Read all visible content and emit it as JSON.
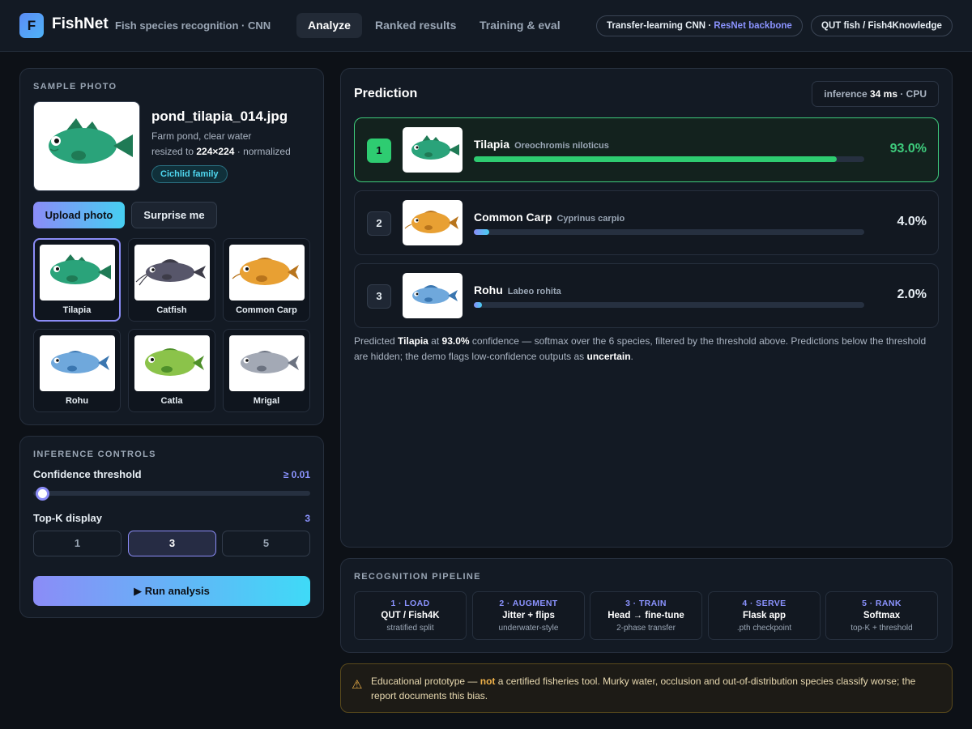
{
  "header": {
    "logo_letter": "F",
    "brand": "FishNet",
    "subtitle": "Fish species recognition · CNN",
    "tabs": [
      {
        "label": "Analyze",
        "active": true
      },
      {
        "label": "Ranked results",
        "active": false
      },
      {
        "label": "Training & eval",
        "active": false
      }
    ],
    "model_pill_prefix": "Transfer-learning CNN · ",
    "model_pill_accent": "ResNet backbone",
    "dataset_pill": "QUT fish / Fish4Knowledge"
  },
  "sample": {
    "section_label": "SAMPLE PHOTO",
    "file_name": "pond_tilapia_014.jpg",
    "description": "Farm pond, clear water",
    "resize_prefix": "resized to ",
    "resize_value": "224×224",
    "resize_suffix": " · normalized",
    "family_badge": "Cichlid family",
    "upload_label": "Upload photo",
    "surprise_label": "Surprise me",
    "species_tiles": [
      {
        "label": "Tilapia",
        "selected": true
      },
      {
        "label": "Catfish",
        "selected": false
      },
      {
        "label": "Common Carp",
        "selected": false
      },
      {
        "label": "Rohu",
        "selected": false
      },
      {
        "label": "Catla",
        "selected": false
      },
      {
        "label": "Mrigal",
        "selected": false
      }
    ]
  },
  "controls": {
    "section_label": "INFERENCE CONTROLS",
    "threshold_label": "Confidence threshold",
    "threshold_value": "≥ 0.01",
    "threshold_level": 0.01,
    "topk_label": "Top-K display",
    "topk_value": "3",
    "topk_options": [
      "1",
      "3",
      "5"
    ],
    "topk_selected": "3",
    "run_label": "▶ Run analysis"
  },
  "prediction": {
    "title": "Prediction",
    "inference_prefix": "inference ",
    "inference_ms": "34 ms",
    "inference_suffix": " · CPU",
    "results": [
      {
        "rank": "1",
        "name": "Tilapia",
        "scientific": "Oreochromis niloticus",
        "percent": "93.0%",
        "value": 93.0
      },
      {
        "rank": "2",
        "name": "Common Carp",
        "scientific": "Cyprinus carpio",
        "percent": "4.0%",
        "value": 4.0
      },
      {
        "rank": "3",
        "name": "Rohu",
        "scientific": "Labeo rohita",
        "percent": "2.0%",
        "value": 2.0
      }
    ],
    "summary_part1": "Predicted ",
    "summary_species": "Tilapia",
    "summary_part2": " at ",
    "summary_percent": "93.0%",
    "summary_part3": " confidence — softmax over the 6 species, filtered by the threshold above. Predictions below the threshold are hidden; the demo flags low-confidence outputs as ",
    "summary_uncertain": "uncertain",
    "summary_end": "."
  },
  "pipeline": {
    "section_label": "RECOGNITION PIPELINE",
    "steps": [
      {
        "num": "1 · LOAD",
        "name": "QUT / Fish4K",
        "sub": "stratified split"
      },
      {
        "num": "2 · AUGMENT",
        "name": "Jitter + flips",
        "sub": "underwater-style"
      },
      {
        "num": "3 · TRAIN",
        "name": "Head → fine-tune",
        "sub": "2-phase transfer"
      },
      {
        "num": "4 · SERVE",
        "name": "Flask app",
        "sub": ".pth checkpoint"
      },
      {
        "num": "5 · RANK",
        "name": "Softmax",
        "sub": "top-K + threshold"
      }
    ]
  },
  "disclaimer": {
    "icon": "warning-icon",
    "part1": "Educational prototype — ",
    "emphasis": "not",
    "part2": " a certified fisheries tool. Murky water, occlusion and out-of-distribution species classify worse; the report documents this bias."
  },
  "colors": {
    "accent": "#8b8cf7",
    "cyan": "#46cff2",
    "success": "#3ecb7c",
    "warning": "#f0b24a"
  }
}
